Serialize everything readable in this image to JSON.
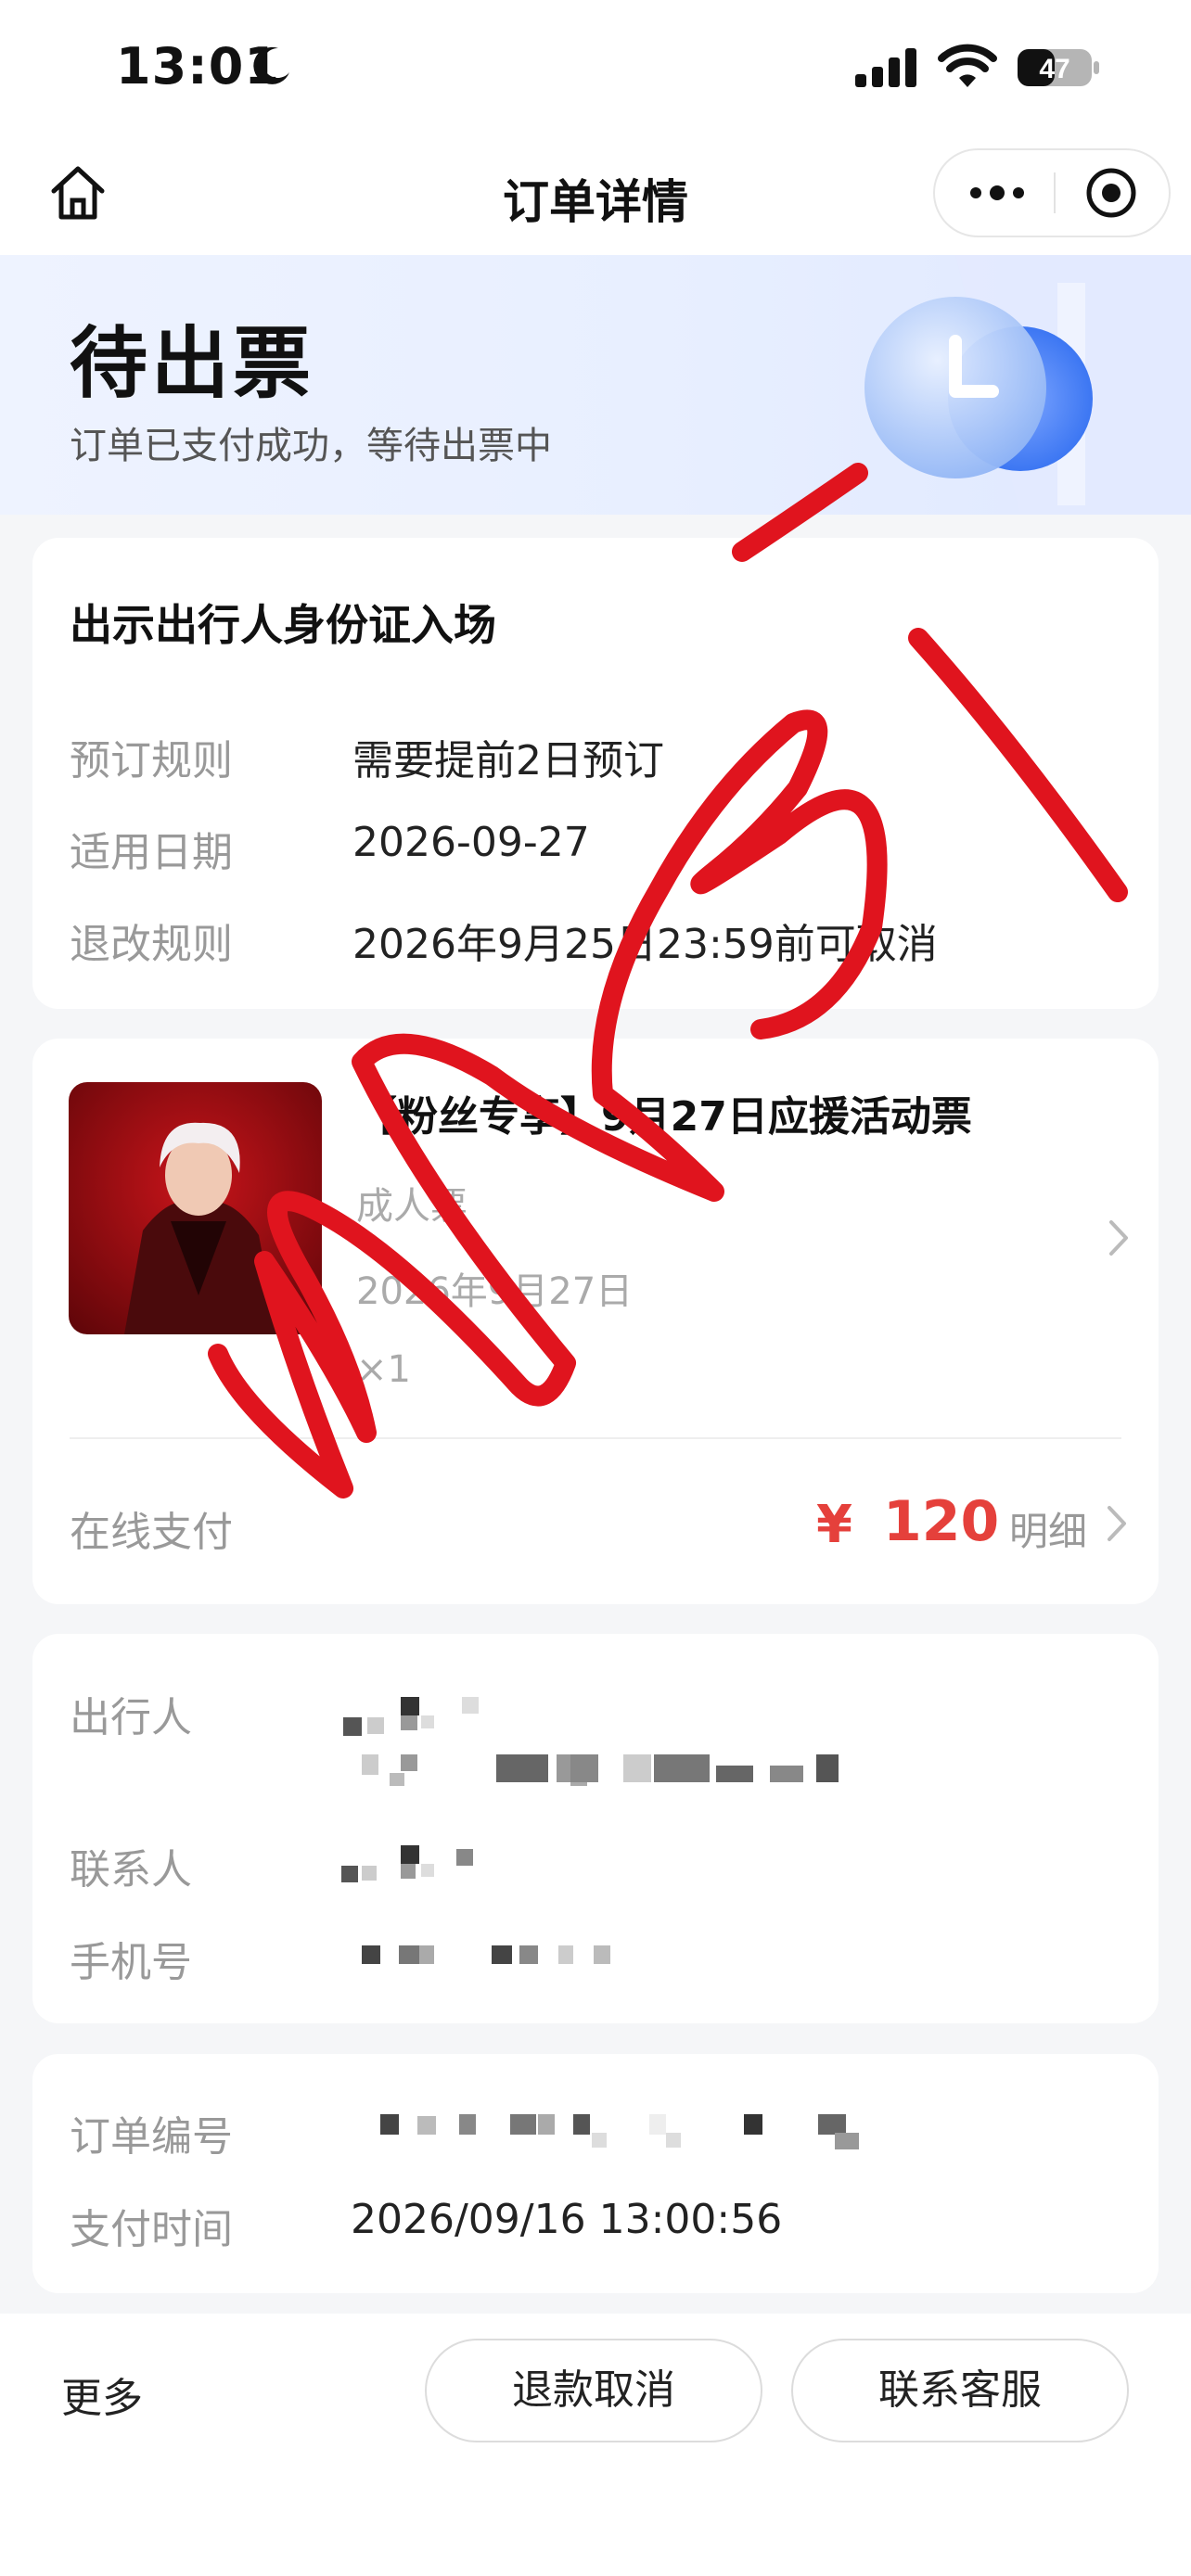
{
  "status_bar": {
    "time": "13:01",
    "battery": "47",
    "icons": [
      "moon-icon",
      "signal-icon",
      "wifi-icon",
      "battery-icon"
    ]
  },
  "nav": {
    "title": "订单详情",
    "icons": [
      "home-icon",
      "more-dots-icon",
      "target-icon"
    ]
  },
  "status": {
    "title": "待出票",
    "subtitle": "订单已支付成功，等待出票中"
  },
  "entry_card": {
    "heading": "出示出行人身份证入场",
    "rows": [
      {
        "label": "预订规则",
        "value": "需要提前2日预订"
      },
      {
        "label": "适用日期",
        "value": "2026-09-27"
      },
      {
        "label": "退改规则",
        "value": "2026年9月25日23:59前可取消"
      }
    ]
  },
  "product": {
    "title": "【粉丝专享】9月27日应援活动票",
    "ticket_type": "成人票",
    "date": "2026年9月27日",
    "quantity": "×1"
  },
  "payment": {
    "label": "在线支付",
    "currency": "¥",
    "amount": "120",
    "detail": "明细"
  },
  "contact_card": {
    "traveler_label": "出行人",
    "contact_label": "联系人",
    "phone_label": "手机号"
  },
  "order_card": {
    "order_no_label": "订单编号",
    "pay_time_label": "支付时间",
    "pay_time": "2026/09/16 13:00:56"
  },
  "bottom": {
    "more": "更多",
    "refund": "退款取消",
    "service": "联系客服"
  },
  "colors": {
    "accent_red": "#e5403b",
    "scribble_red": "#e0141e",
    "hero_bg": "#eaf0ff"
  }
}
